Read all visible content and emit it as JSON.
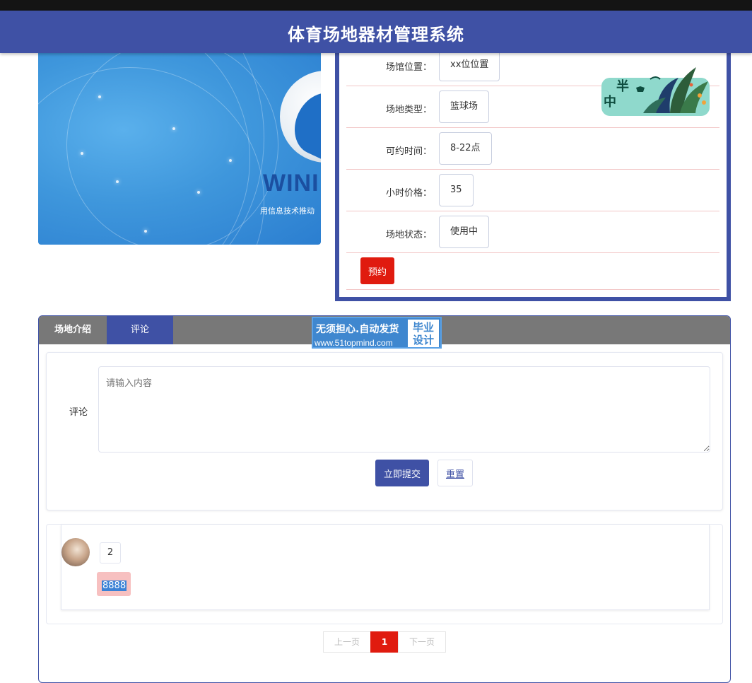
{
  "header": {
    "title": "体育场地器材管理系统"
  },
  "banner": {
    "brand": "WINI",
    "slogan": "用信息技术推动"
  },
  "details": [
    {
      "label": "场馆位置：",
      "value": "xx位位置"
    },
    {
      "label": "场地类型：",
      "value": "篮球场"
    },
    {
      "label": "可约时间：",
      "value": "8-22点"
    },
    {
      "label": "小时价格：",
      "value": "35"
    },
    {
      "label": "场地状态：",
      "value": "使用中"
    }
  ],
  "actions": {
    "book": "预约"
  },
  "sticker": {
    "text1": "半",
    "text2": "中"
  },
  "tabs": {
    "intro": "场地介绍",
    "comment": "评论"
  },
  "promo": {
    "line1": "无须担心.自动发货",
    "line2": "www.51topmind.com",
    "badge_top": "毕业",
    "badge_bottom": "设计"
  },
  "form": {
    "label": "评论",
    "placeholder": "请输入内容",
    "submit": "立即提交",
    "reset": "重置"
  },
  "comments": [
    {
      "user": "2",
      "content": "8888"
    }
  ],
  "pager": {
    "prev": "上一页",
    "current": "1",
    "next": "下一页"
  },
  "colors": {
    "primary": "#3f51a5",
    "danger": "#e01b0f",
    "tabbar": "#787878"
  }
}
